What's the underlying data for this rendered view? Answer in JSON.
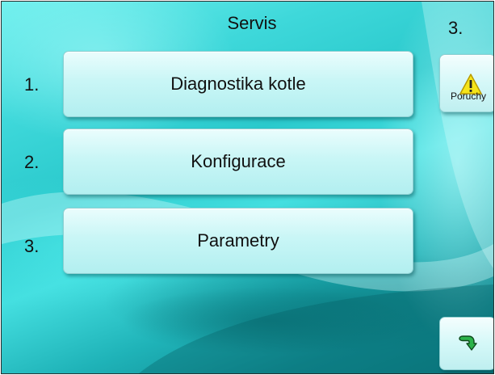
{
  "header": {
    "title": "Servis",
    "page_number": "3."
  },
  "menu": {
    "items": [
      {
        "number": "1.",
        "label": "Diagnostika kotle"
      },
      {
        "number": "2.",
        "label": "Konfigurace"
      },
      {
        "number": "3.",
        "label": "Parametry"
      }
    ]
  },
  "side": {
    "poruchy_label": "Poruchy",
    "poruchy_icon": "warning-triangle-icon",
    "back_icon": "return-arrow-icon"
  },
  "colors": {
    "background_light": "#6ff0ee",
    "background_dark": "#0c7f86",
    "button_face": "#c9f6f6",
    "warning_yellow": "#f5e51a",
    "arrow_green": "#2bb34a"
  }
}
